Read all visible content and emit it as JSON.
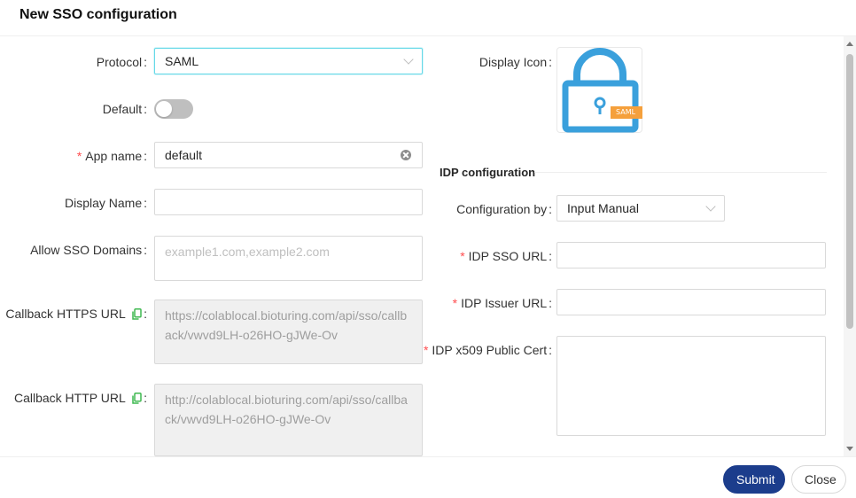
{
  "modal": {
    "title": "New SSO configuration"
  },
  "form": {
    "protocol": {
      "label": "Protocol",
      "value": "SAML"
    },
    "default": {
      "label": "Default",
      "enabled": false
    },
    "app_name": {
      "label": "App name",
      "value": "default"
    },
    "display_name": {
      "label": "Display Name",
      "value": ""
    },
    "allow_domains": {
      "label": "Allow SSO Domains",
      "placeholder": "example1.com,example2.com"
    },
    "callback_https": {
      "label": "Callback HTTPS URL",
      "value": "https://colablocal.bioturing.com/api/sso/callback/vwvd9LH-o26HO-gJWe-Ov"
    },
    "callback_http": {
      "label": "Callback HTTP URL",
      "value": "http://colablocal.bioturing.com/api/sso/callback/vwvd9LH-o26HO-gJWe-Ov"
    },
    "display_icon": {
      "label": "Display Icon",
      "badge": "SAML",
      "icon": "padlock-icon"
    }
  },
  "idp": {
    "section_title": "IDP configuration",
    "configuration_by": {
      "label": "Configuration by",
      "value": "Input Manual"
    },
    "sso_url": {
      "label": "IDP SSO URL",
      "value": ""
    },
    "issuer_url": {
      "label": "IDP Issuer URL",
      "value": ""
    },
    "x509_cert": {
      "label": "IDP x509 Public Cert",
      "value": ""
    }
  },
  "footer": {
    "submit_label": "Submit",
    "close_label": "Close"
  },
  "colors": {
    "primary": "#1c3d8c",
    "required": "#ff4d4f",
    "icon_blue": "#3aa0dc",
    "icon_orange": "#f5a03c",
    "copy_green": "#3fb950"
  }
}
